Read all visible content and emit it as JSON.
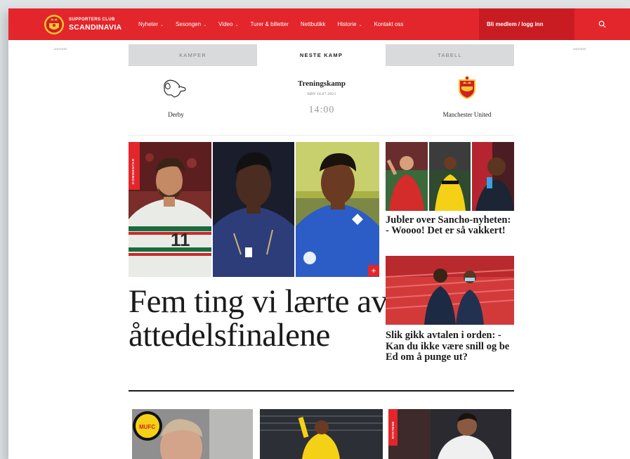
{
  "brand": {
    "line1": "SUPPORTERS CLUB",
    "line2": "SCANDINAVIA"
  },
  "nav": {
    "items": [
      {
        "label": "Nyheter",
        "dropdown": true
      },
      {
        "label": "Sesongen",
        "dropdown": true
      },
      {
        "label": "Video",
        "dropdown": true
      },
      {
        "label": "Turer & billetter",
        "dropdown": false
      },
      {
        "label": "Nettbutikk",
        "dropdown": false
      },
      {
        "label": "Historie",
        "dropdown": true
      },
      {
        "label": "Kontakt oss",
        "dropdown": false
      }
    ],
    "member_label": "Bli medlem / logg inn",
    "search_icon": "search-icon"
  },
  "ads": {
    "left": "ANNONSE",
    "right": "ANNONSE"
  },
  "match_widget": {
    "tabs": [
      {
        "label": "KAMPER",
        "active": false
      },
      {
        "label": "NESTE KAMP",
        "active": true
      },
      {
        "label": "TABELL",
        "active": false
      }
    ],
    "home_team": "Derby",
    "away_team": "Manchester United",
    "match_type": "Treningskamp",
    "date": "SØN 18.07.2021",
    "time": "14:00"
  },
  "main_article": {
    "tag": "KOMMENTAR",
    "headline": "Fem ting vi lærte av åttedelsfinalene",
    "badge": "+"
  },
  "side_articles": [
    {
      "headline": "Jubler over Sancho-nyheten: - Woooo! Det er så vakkert!"
    },
    {
      "headline": "Slik gikk avtalen i orden: - Kan du ikke være snill og be Ed om å punge ut?"
    }
  ],
  "bottom_cards": [
    {
      "tag": ""
    },
    {
      "tag": ""
    },
    {
      "tag": "RYKTENE"
    }
  ],
  "colors": {
    "brand_red": "#e3262b",
    "dark_red": "#c91c22",
    "text": "#1b1b1b"
  }
}
